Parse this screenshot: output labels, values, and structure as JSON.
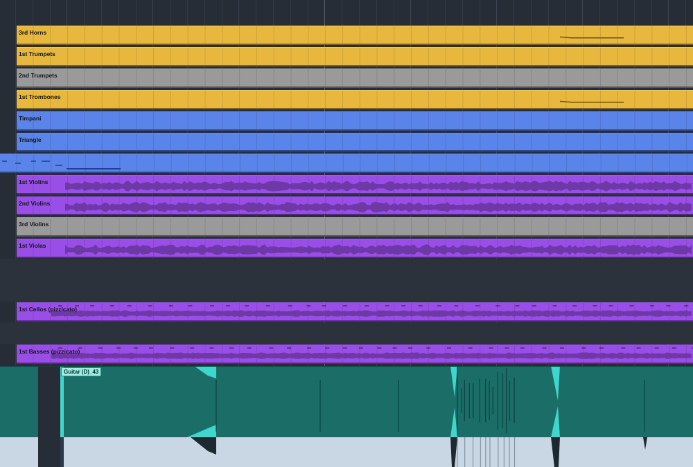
{
  "tracks": [
    {
      "name": "3rd Horns",
      "color": "#e8b83e",
      "kind": "midi"
    },
    {
      "name": "1st Trumpets",
      "color": "#e8b83e",
      "kind": "midi"
    },
    {
      "name": "2nd Trumpets",
      "color": "#9a9a9a",
      "kind": "midi"
    },
    {
      "name": "1st Trombones",
      "color": "#e8b83e",
      "kind": "midi"
    },
    {
      "name": "Timpani",
      "color": "#5b84ea",
      "kind": "midi"
    },
    {
      "name": "Triangle",
      "color": "#5b84ea",
      "kind": "midi"
    },
    {
      "name": "",
      "color": "#5b84ea",
      "kind": "midi"
    },
    {
      "name": "1st Violins",
      "color": "#9a4ee8",
      "kind": "audio"
    },
    {
      "name": "2nd Violins",
      "color": "#9a4ee8",
      "kind": "audio"
    },
    {
      "name": "3rd Violins",
      "color": "#9a9a9a",
      "kind": "midi"
    },
    {
      "name": "1st Violas",
      "color": "#9a4ee8",
      "kind": "audio"
    },
    {
      "name": "1st Cellos (pizzicato)",
      "color": "#9a4ee8",
      "kind": "audio"
    },
    {
      "name": "1st Basses (pizzicato)",
      "color": "#9a4ee8",
      "kind": "audio"
    }
  ],
  "guitar": {
    "name": "Guitar (D)_43",
    "color": "#1b6e68",
    "lower_color": "#c9d7e5",
    "highlight_color": "#3fd6cc"
  },
  "colors": {
    "background": "#262d36",
    "gridline": "#323a45"
  }
}
